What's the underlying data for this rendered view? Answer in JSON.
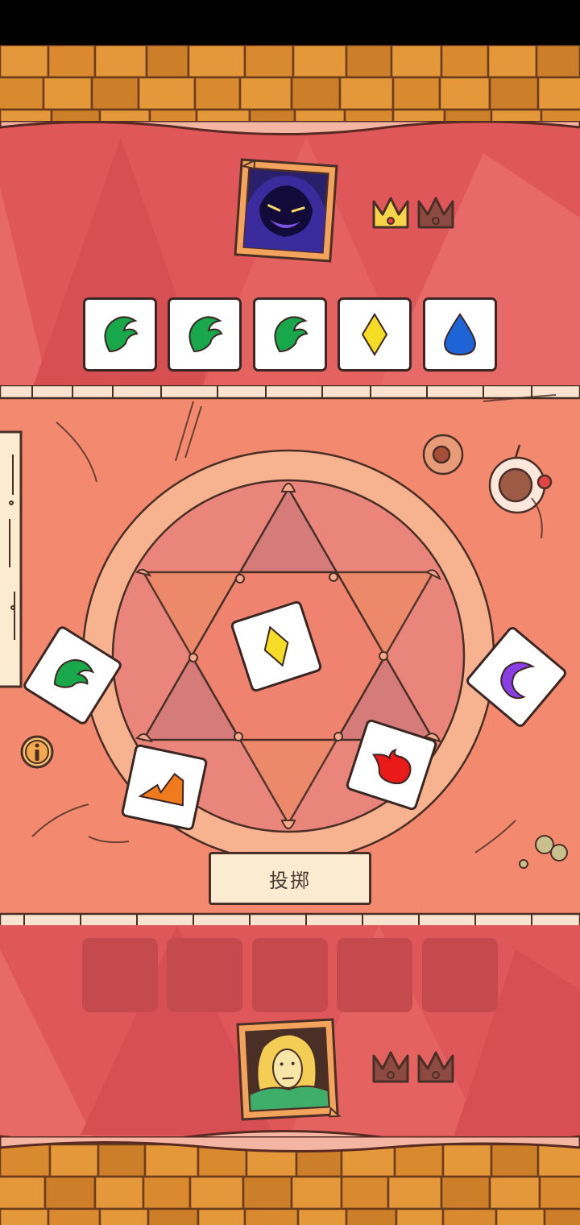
{
  "roll_button": {
    "label": "投掷"
  },
  "opponent": {
    "avatar": "shadow-monster-portrait",
    "crowns": [
      {
        "state": "won",
        "color": "#f7d54a"
      },
      {
        "state": "empty",
        "color": "#8c4a42"
      }
    ],
    "held_dice": [
      {
        "face": "leaf",
        "color": "#18a84b"
      },
      {
        "face": "leaf",
        "color": "#18a84b"
      },
      {
        "face": "leaf",
        "color": "#18a84b"
      },
      {
        "face": "diamond",
        "color": "#f5dd25"
      },
      {
        "face": "water-drop",
        "color": "#1e64d6"
      }
    ]
  },
  "player": {
    "avatar": "blonde-hero-portrait",
    "crowns": [
      {
        "state": "empty",
        "color": "#8c4a42"
      },
      {
        "state": "empty",
        "color": "#8c4a42"
      }
    ],
    "held_slots": 5
  },
  "rolled_dice": [
    {
      "face": "leaf",
      "color": "#18a84b"
    },
    {
      "face": "diamond",
      "color": "#f5dd25"
    },
    {
      "face": "moon",
      "color": "#8a3ee6"
    },
    {
      "face": "mountain",
      "color": "#f07a1c"
    },
    {
      "face": "fire",
      "color": "#ea1a1a"
    }
  ],
  "colors": {
    "band": "#e0575a",
    "table": "#f3896f",
    "wood": "#d8892e",
    "circle": "#f7b28f"
  }
}
